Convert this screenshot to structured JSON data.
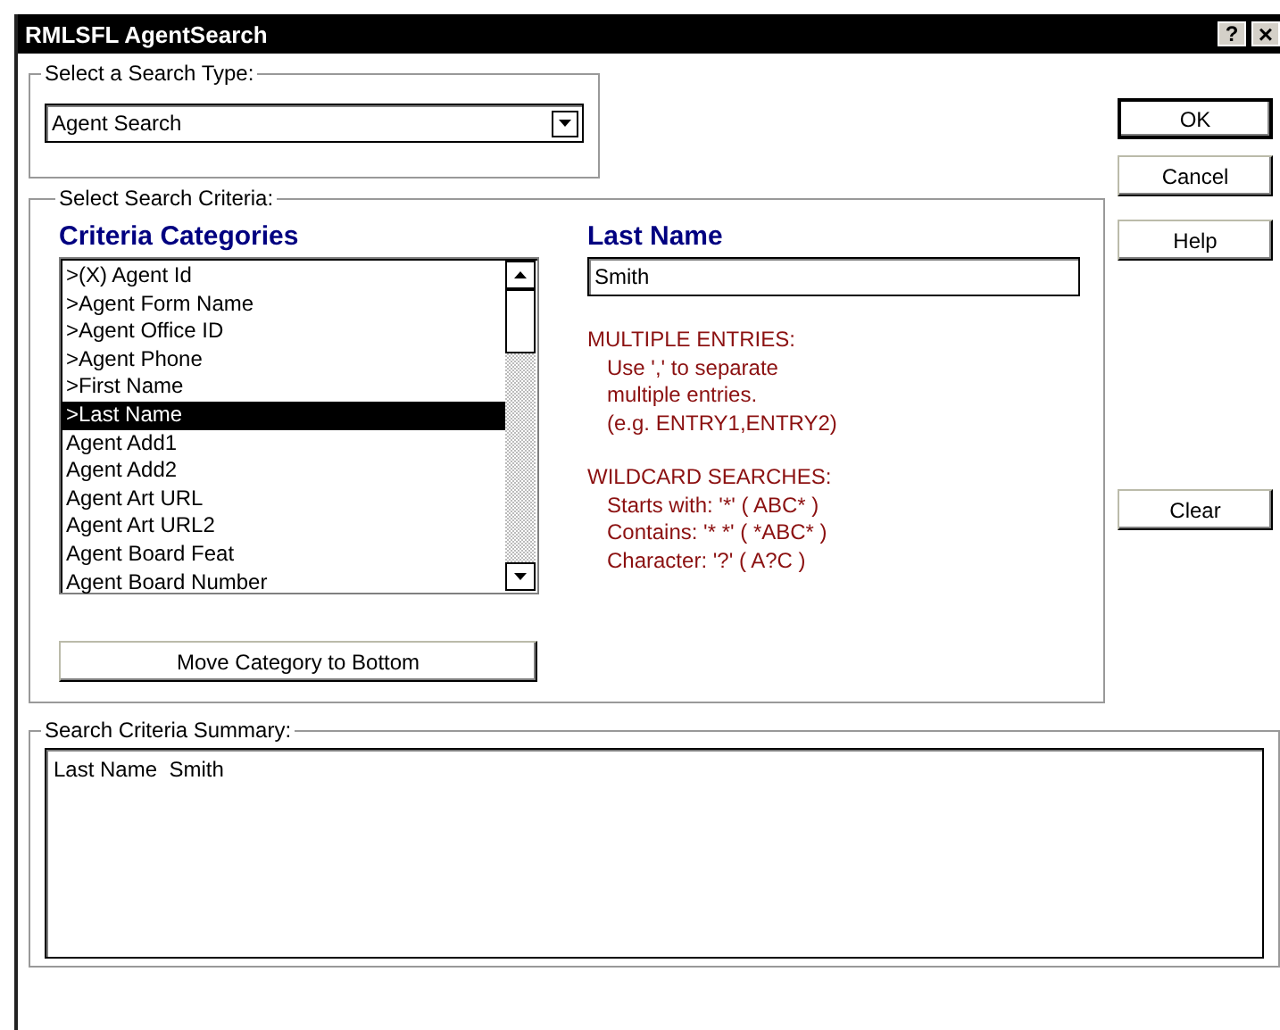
{
  "window": {
    "title": "RMLSFL AgentSearch",
    "title_buttons": [
      {
        "kind": "help",
        "label": "?"
      },
      {
        "kind": "close",
        "label": "×"
      }
    ]
  },
  "search_type": {
    "label": "Select a Search Type:",
    "value": "Agent Search"
  },
  "criteria": {
    "label": "Select Search Criteria:",
    "categories": {
      "heading": "Criteria Categories",
      "items": [
        {
          "label": ">(X) Agent Id",
          "selected": false
        },
        {
          "label": ">Agent Form Name",
          "selected": false
        },
        {
          "label": ">Agent Office ID",
          "selected": false
        },
        {
          "label": ">Agent Phone",
          "selected": false
        },
        {
          "label": ">First Name",
          "selected": false
        },
        {
          "label": ">Last Name",
          "selected": true
        },
        {
          "label": "Agent Add1",
          "selected": false
        },
        {
          "label": "Agent Add2",
          "selected": false
        },
        {
          "label": "Agent Art URL",
          "selected": false
        },
        {
          "label": "Agent Art URL2",
          "selected": false
        },
        {
          "label": "Agent Board Feat",
          "selected": false
        },
        {
          "label": "Agent Board Number",
          "selected": false
        }
      ]
    },
    "move_button": "Move Category to Bottom",
    "field": {
      "heading": "Last Name",
      "value": "Smith"
    },
    "help_sections": [
      {
        "heading": "MULTIPLE ENTRIES:",
        "lines": [
          "Use ',' to separate",
          "multiple entries.",
          "(e.g. ENTRY1,ENTRY2)"
        ]
      },
      {
        "heading": "WILDCARD SEARCHES:",
        "lines": [
          "Starts with: '*' ( ABC* )",
          "Contains: '* *' ( *ABC* )",
          "Character: '?' ( A?C )"
        ]
      }
    ]
  },
  "buttons": [
    {
      "label": "OK",
      "default": true
    },
    {
      "label": "Cancel",
      "default": false
    },
    {
      "label": "Help",
      "default": false
    }
  ],
  "clear_button": "Clear",
  "summary": {
    "label": "Search Criteria Summary:",
    "lines": [
      "Last Name  Smith"
    ]
  }
}
